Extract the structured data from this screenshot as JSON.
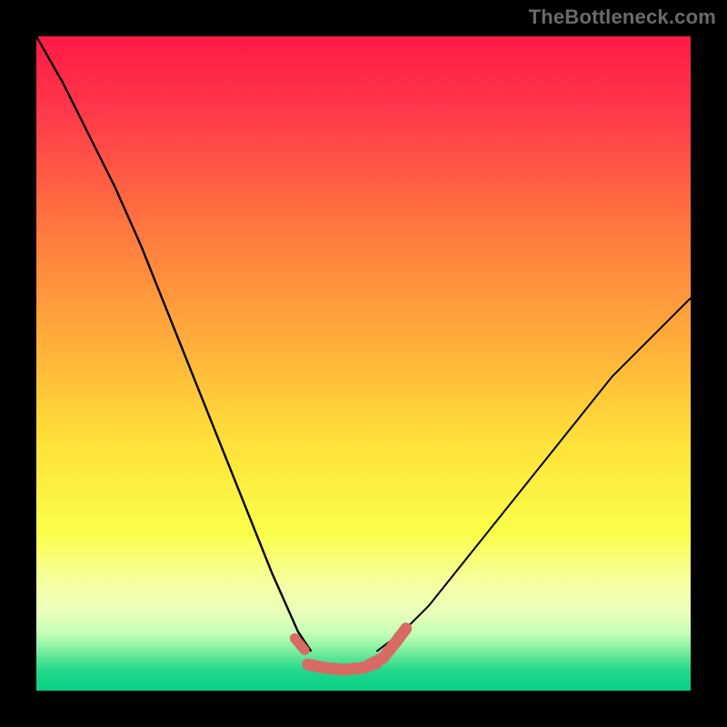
{
  "watermark": "TheBottleneck.com",
  "chart_data": {
    "type": "line",
    "title": "",
    "xlabel": "",
    "ylabel": "",
    "xlim": [
      0,
      100
    ],
    "ylim": [
      0,
      100
    ],
    "grid": false,
    "legend": false,
    "gradient_stops": [
      {
        "pct": 0,
        "color": "#ff1a44"
      },
      {
        "pct": 12,
        "color": "#ff3a4a"
      },
      {
        "pct": 30,
        "color": "#ff7a3e"
      },
      {
        "pct": 48,
        "color": "#ffb23a"
      },
      {
        "pct": 62,
        "color": "#ffe13a"
      },
      {
        "pct": 76,
        "color": "#faff4a"
      },
      {
        "pct": 84,
        "color": "#f6ffa6"
      },
      {
        "pct": 88,
        "color": "#e9ffba"
      },
      {
        "pct": 91,
        "color": "#c8ffb5"
      },
      {
        "pct": 93,
        "color": "#97f5a8"
      },
      {
        "pct": 95,
        "color": "#5be595"
      },
      {
        "pct": 97,
        "color": "#20d88a"
      },
      {
        "pct": 100,
        "color": "#08d084"
      }
    ],
    "series": [
      {
        "name": "bottleneck-left",
        "color": "#000000",
        "width": 2.4,
        "x": [
          0,
          4,
          8,
          12,
          16,
          20,
          24,
          28,
          32,
          36,
          40,
          42
        ],
        "values": [
          100,
          93,
          85,
          77,
          68,
          58,
          48,
          38,
          28,
          18,
          9,
          6
        ]
      },
      {
        "name": "bottleneck-right",
        "color": "#000000",
        "width": 2.0,
        "x": [
          52,
          56,
          60,
          64,
          68,
          72,
          76,
          80,
          84,
          88,
          92,
          96,
          100
        ],
        "values": [
          6,
          9,
          13,
          18,
          23,
          28,
          33,
          38,
          43,
          48,
          52,
          56,
          60
        ]
      },
      {
        "name": "marker-left-dot",
        "color": "#d86a64",
        "width": 11,
        "cap": "round",
        "x": [
          39.5,
          41.0
        ],
        "values": [
          8.0,
          6.2
        ]
      },
      {
        "name": "marker-flat",
        "color": "#d86a64",
        "width": 13,
        "cap": "round",
        "x": [
          41.5,
          44.0,
          47.0,
          50.0,
          52.0
        ],
        "values": [
          4.0,
          3.5,
          3.2,
          3.5,
          4.2
        ]
      },
      {
        "name": "marker-right-up",
        "color": "#d86a64",
        "width": 13,
        "cap": "round",
        "x": [
          50.0,
          53.0,
          55.0,
          56.5
        ],
        "values": [
          3.5,
          5.0,
          7.5,
          9.5
        ]
      }
    ]
  }
}
